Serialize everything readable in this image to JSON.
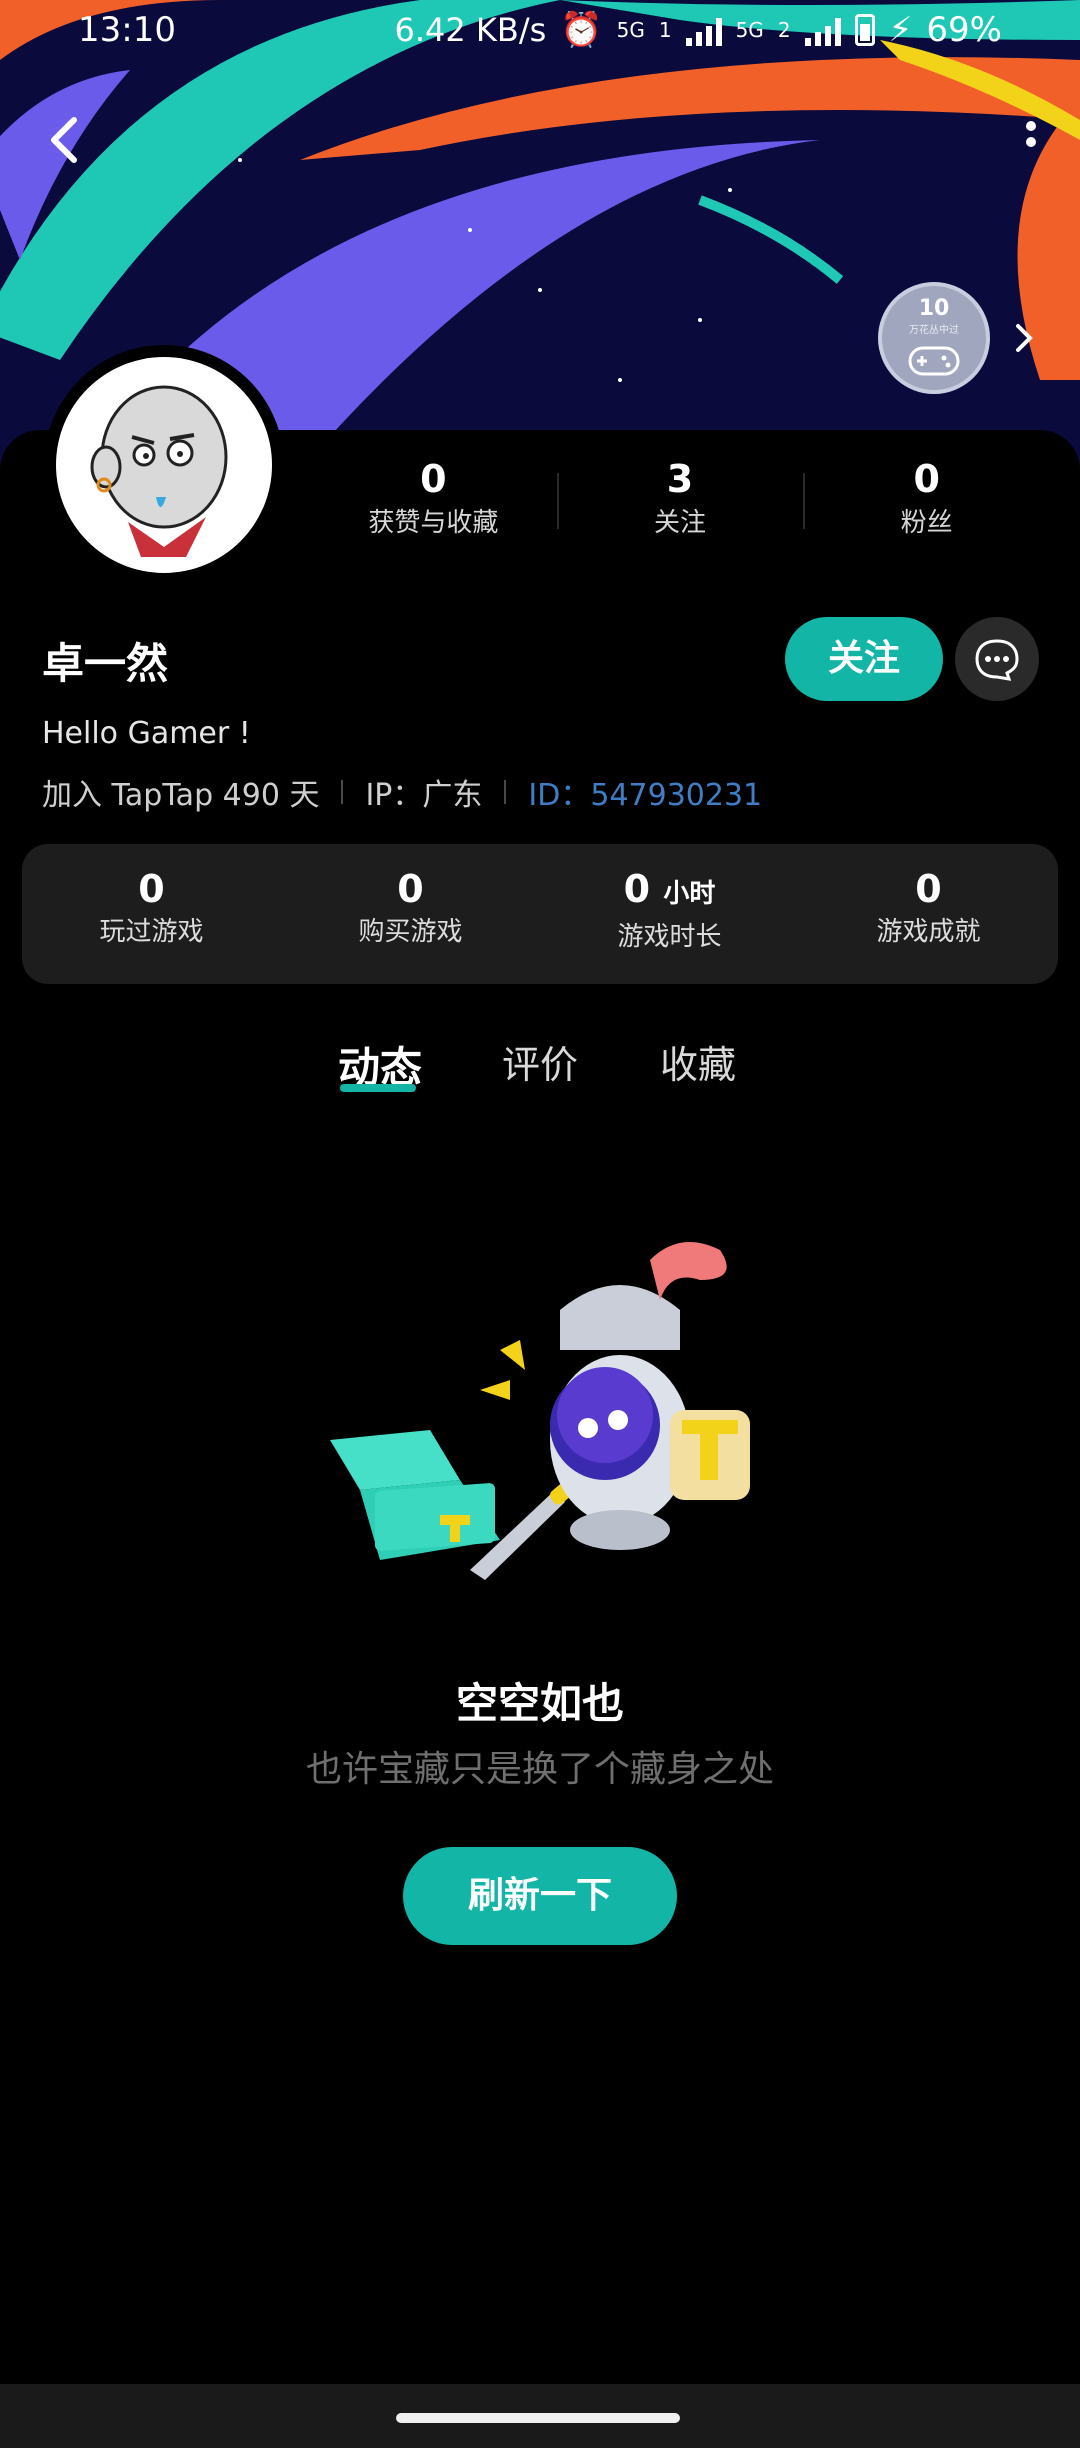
{
  "status_bar": {
    "time": "13:10",
    "net_speed": "6.42 KB/s",
    "sig1": "5G",
    "sig1_sub": "1",
    "sig2": "5G",
    "sig2_sub": "2",
    "battery_pct": "69%"
  },
  "header": {
    "badge_num": "10",
    "badge_sub": "万花丛中过"
  },
  "stats": [
    {
      "value": "0",
      "label": "获赞与收藏"
    },
    {
      "value": "3",
      "label": "关注"
    },
    {
      "value": "0",
      "label": "粉丝"
    }
  ],
  "profile": {
    "name": "卓一然",
    "follow_label": "关注",
    "bio": "Hello Gamer !",
    "joined": "加入 TapTap 490 天",
    "ip": "IP：广东",
    "id": "ID：547930231"
  },
  "game_stats": [
    {
      "value": "0",
      "unit": "",
      "label": "玩过游戏"
    },
    {
      "value": "0",
      "unit": "",
      "label": "购买游戏"
    },
    {
      "value": "0",
      "unit": "小时",
      "label": "游戏时长"
    },
    {
      "value": "0",
      "unit": "",
      "label": "游戏成就"
    }
  ],
  "tabs": [
    "动态",
    "评价",
    "收藏"
  ],
  "empty_state": {
    "title": "空空如也",
    "subtitle": "也许宝藏只是换了个藏身之处",
    "refresh_label": "刷新一下"
  },
  "colors": {
    "accent": "#12b5a6",
    "id_link": "#3f7ec4",
    "banner_bg": "#0a0a3c",
    "banner_teal": "#1fc7b5",
    "banner_orange": "#f2602a",
    "banner_purple": "#6b5bea",
    "banner_yellow": "#f3d21a"
  }
}
